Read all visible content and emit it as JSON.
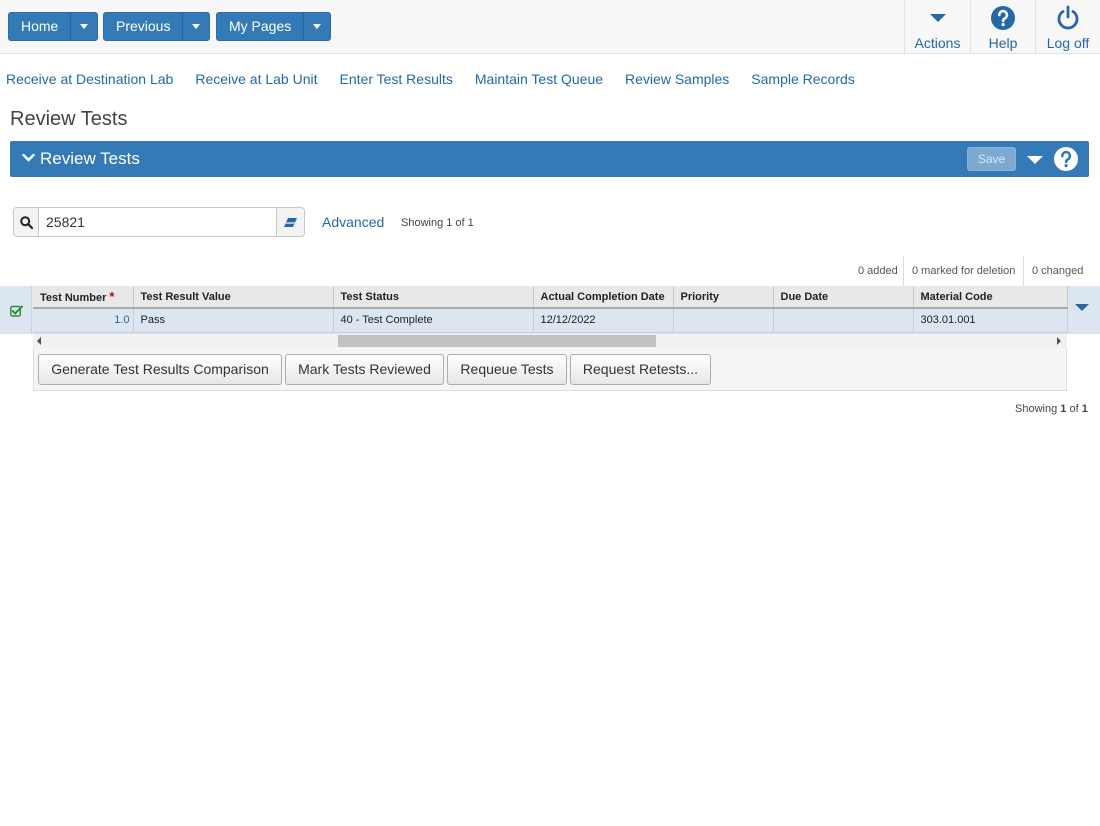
{
  "nav": {
    "home": "Home",
    "previous": "Previous",
    "my_pages": "My Pages",
    "actions": "Actions",
    "help": "Help",
    "logoff": "Log off"
  },
  "sublinks": [
    "Receive at Destination Lab",
    "Receive at Lab Unit",
    "Enter Test Results",
    "Maintain Test Queue",
    "Review Samples",
    "Sample Records"
  ],
  "page_title": "Review Tests",
  "panel": {
    "title": "Review Tests",
    "save_label": "Save"
  },
  "search": {
    "value": "25821",
    "advanced_label": "Advanced",
    "showing": "Showing 1 of 1"
  },
  "counters": {
    "added": "0 added",
    "marked": "0 marked for deletion",
    "changed": "0 changed"
  },
  "grid": {
    "columns": [
      "Test Number",
      "Test Result Value",
      "Test Status",
      "Actual Completion Date",
      "Priority",
      "Due Date",
      "Material Code"
    ],
    "rows": [
      {
        "test_number": "1.0",
        "result_value": "Pass",
        "status": "40 - Test Complete",
        "completion_date": "12/12/2022",
        "priority": "",
        "due_date": "",
        "material_code": "303.01.001"
      }
    ]
  },
  "buttons": {
    "generate": "Generate Test Results Comparison",
    "mark_reviewed": "Mark Tests Reviewed",
    "requeue": "Requeue Tests",
    "request_retests": "Request Retests..."
  },
  "footer": {
    "showing_prefix": "Showing ",
    "showing_current": "1",
    "showing_of": " of ",
    "showing_total": "1"
  },
  "colors": {
    "primary": "#337ab7",
    "link": "#2468a8",
    "row_selected": "#dce6f1"
  }
}
